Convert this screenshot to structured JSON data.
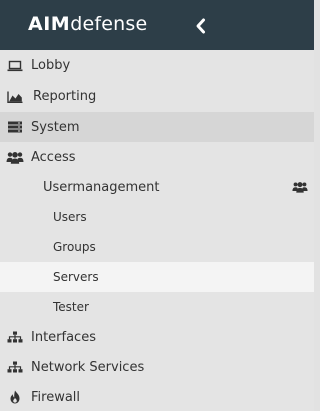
{
  "header": {
    "logo_strong": "AIM",
    "logo_light": "defense"
  },
  "menu": {
    "lobby": "Lobby",
    "reporting": "Reporting",
    "system": "System",
    "access": "Access",
    "usermanagement": "Usermanagement",
    "users": "Users",
    "groups": "Groups",
    "servers": "Servers",
    "tester": "Tester",
    "interfaces": "Interfaces",
    "network_services": "Network Services",
    "firewall": "Firewall"
  },
  "colors": {
    "header_bg": "#2d3e48",
    "sidebar_bg": "#e4e4e4",
    "selected_bg": "#d6d6d6",
    "active_bg": "#f4f4f4",
    "text": "#333333"
  },
  "icons": {
    "lobby": "laptop-icon",
    "reporting": "area-chart-icon",
    "system": "server-icon",
    "access": "users-icon",
    "usermanagement": "users-icon",
    "interfaces": "sitemap-icon",
    "network_services": "sitemap-icon",
    "firewall": "fire-icon",
    "collapse": "chevron-left-icon"
  }
}
